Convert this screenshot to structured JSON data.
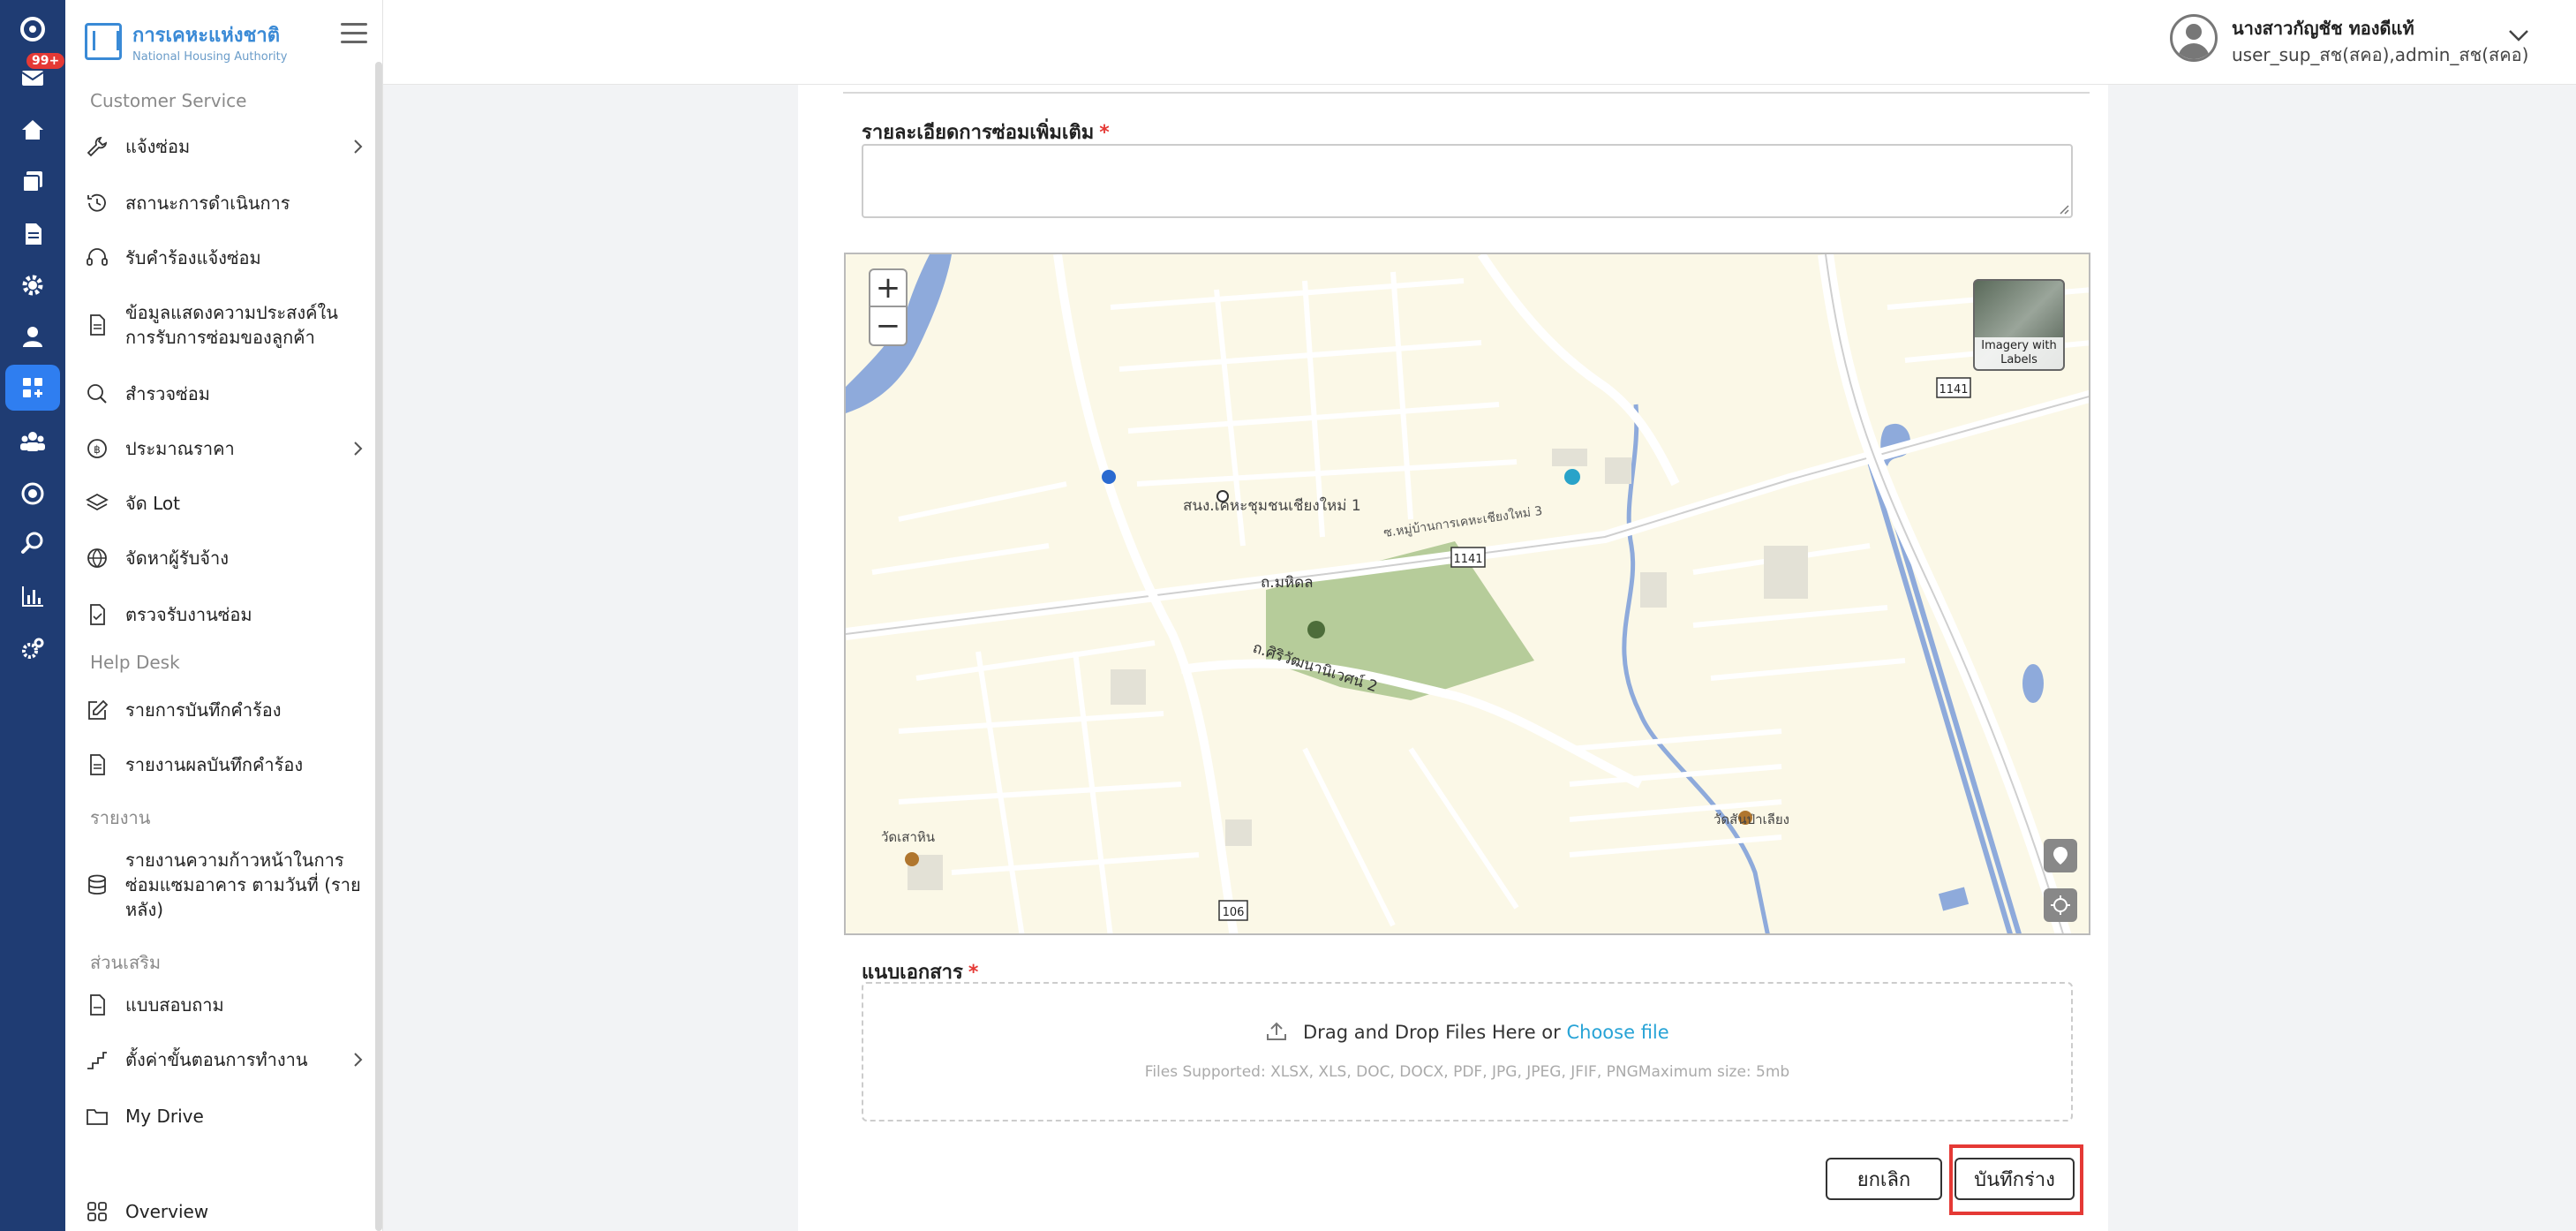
{
  "rail": {
    "badge": "99+"
  },
  "sidebar": {
    "logo_th": "การเคหะแห่งชาติ",
    "logo_en": "National Housing Authority",
    "sections": {
      "customer_service": "Customer Service",
      "help_desk": "Help Desk",
      "report": "รายงาน",
      "extras": "ส่วนเสริม"
    },
    "items": {
      "repair_notify": "แจ้งซ่อม",
      "status": "สถานะการดำเนินการ",
      "receive_request": "รับคำร้องแจ้งซ่อม",
      "customer_info": "ข้อมูลแสดงความประสงค์ใน การรับการซ่อมของลูกค้า",
      "survey_repair": "สำรวจซ่อม",
      "estimate": "ประมาณราคา",
      "lot": "จัด Lot",
      "contractor": "จัดหาผู้รับจ้าง",
      "inspect": "ตรวจรับงานซ่อม",
      "request_log": "รายการบันทึกคำร้อง",
      "request_report": "รายงานผลบันทึกคำร้อง",
      "progress_report": "รายงานความก้าวหน้าในการ ซ่อมแซมอาคาร ตามวันที่ (ราย หลัง)",
      "questionnaire": "แบบสอบถาม",
      "workflow": "ตั้งค่าขั้นตอนการทำงาน",
      "my_drive": "My Drive",
      "overview": "Overview"
    }
  },
  "header": {
    "user_name": "นางสาวกัญชัช ทองดีแท้",
    "user_role": "user_sup_สช(สคอ),admin_สช(สคอ)"
  },
  "form": {
    "detail_label": "รายละเอียดการซ่อมเพิ่มเติม",
    "required_mark": "*",
    "attach_label": "แนบเอกสาร",
    "drop_text": "Drag and Drop Files Here or",
    "choose_file": "Choose file",
    "supported": "Files Supported: XLSX, XLS, DOC, DOCX, PDF, JPG, JPEG, JFIF, PNGMaximum size: 5mb",
    "cancel": "ยกเลิก",
    "save_draft": "บันทึกร่าง"
  },
  "map": {
    "zoom_in": "+",
    "zoom_out": "−",
    "imagery_label": "Imagery with Labels",
    "labels": {
      "school": "สนง.เคหะชุมชนเชียงใหม่ 1",
      "road_mahidol": "ถ.มหิดล",
      "road_srirat": "ถ.ศิริวัฒนานิเวศน์ 2",
      "road_soi": "ซ.หมู่บ้านการเคหะเชียงใหม่ 3",
      "route_1141a": "1141",
      "route_1141b": "1141",
      "route_106": "106",
      "temple": "วัดสันป่าเลียง",
      "temple2": "วัดเสาหิน"
    }
  },
  "colors": {
    "rail": "#1f3c73",
    "accent": "#2f7ef0",
    "required": "#e53935",
    "link": "#27a3d6"
  }
}
